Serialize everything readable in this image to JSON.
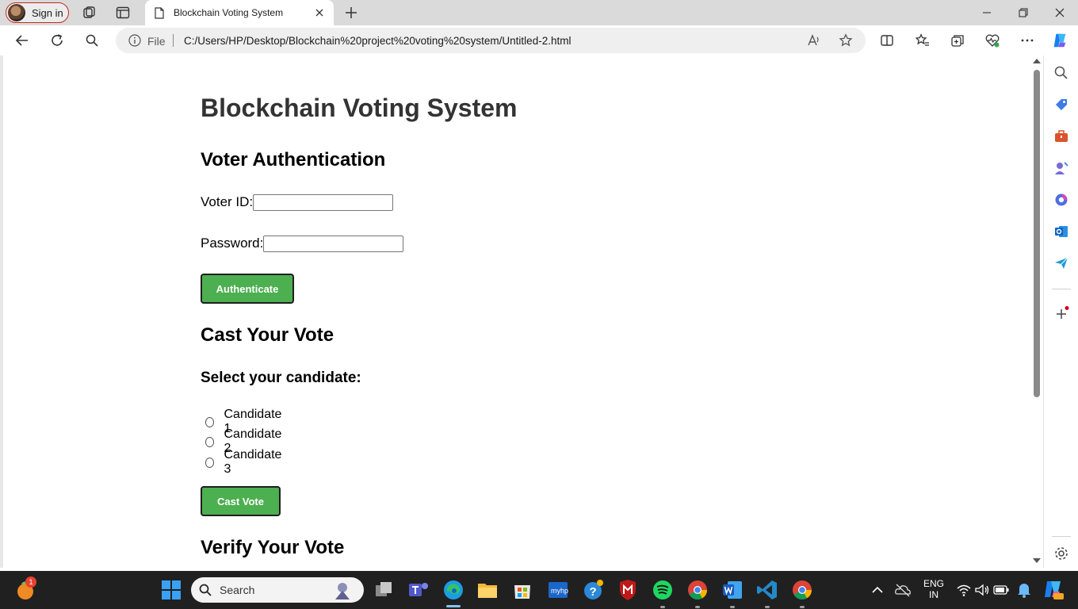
{
  "browser": {
    "sign_in_label": "Sign in",
    "tab_title": "Blockchain Voting System",
    "url_scheme_label": "File",
    "url": "C:/Users/HP/Desktop/Blockchain%20project%20voting%20system/Untitled-2.html"
  },
  "page": {
    "title": "Blockchain Voting System",
    "auth": {
      "heading": "Voter Authentication",
      "voter_id_label": "Voter ID:",
      "voter_id_value": "",
      "password_label": "Password:",
      "password_value": "",
      "button_label": "Authenticate"
    },
    "vote": {
      "heading": "Cast Your Vote",
      "subheading": "Select your candidate:",
      "candidates": [
        "Candidate 1",
        "Candidate 2",
        "Candidate 3"
      ],
      "button_label": "Cast Vote"
    },
    "verify": {
      "heading": "Verify Your Vote"
    }
  },
  "taskbar": {
    "search_label": "Search",
    "widgets_badge": "1",
    "language_line1": "ENG",
    "language_line2": "IN"
  },
  "colors": {
    "button_green": "#4caf50",
    "tabbar_bg": "#dadada",
    "taskbar_bg": "#202020"
  }
}
